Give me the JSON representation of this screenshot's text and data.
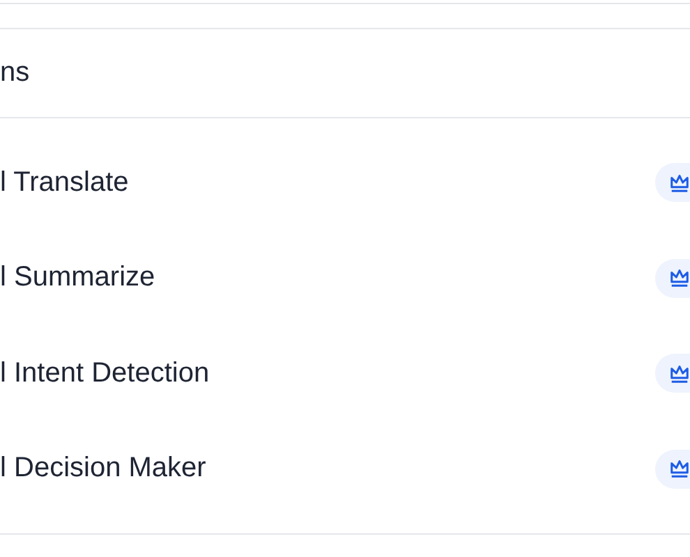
{
  "section": {
    "title": "ns",
    "items": [
      {
        "label": "l Translate"
      },
      {
        "label": "l Summarize"
      },
      {
        "label": "l Intent Detection"
      },
      {
        "label": "l Decision Maker"
      }
    ]
  }
}
